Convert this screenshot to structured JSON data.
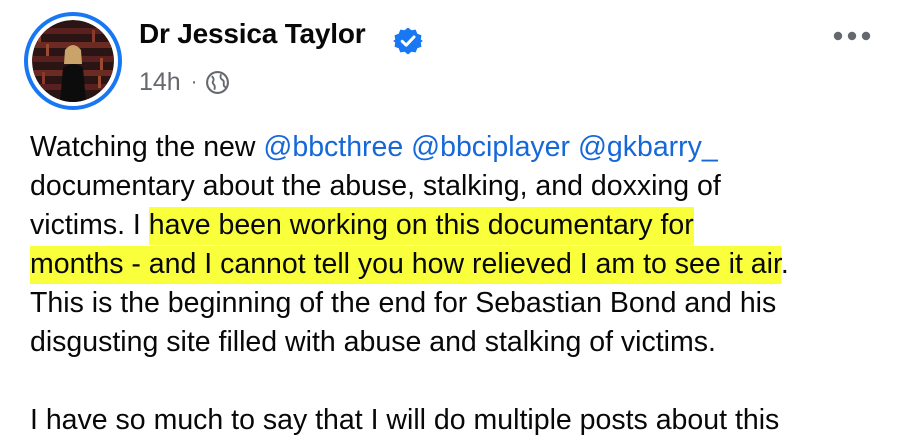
{
  "post": {
    "author_name": "Dr Jessica Taylor",
    "timestamp": "14h",
    "separator": "·",
    "visibility_icon": "globe-icon",
    "verified_icon": "verified-badge-icon",
    "more_icon": "more-options-icon",
    "body": {
      "line1_text": "Watching the new ",
      "mentions": [
        "@bbcthree",
        "@bbciplayer",
        "@gkbarry_"
      ],
      "line2": "documentary about the abuse, stalking, and doxxing of",
      "line3_plain": "victims. I ",
      "line3_highlight": "have been working on this documentary for",
      "line4_highlight": "months - and I cannot tell you how relieved I am to see it air",
      "line4_end": ".",
      "line5": "This is the beginning of the end for Sebastian Bond and his",
      "line6": "disgusting site filled with abuse and stalking of victims.",
      "line7": "I have so much to say that I will do multiple posts about this"
    }
  },
  "colors": {
    "accent": "#1877f2",
    "mention": "#1668d8",
    "highlight": "#faff3c",
    "meta_text": "#65686c"
  }
}
